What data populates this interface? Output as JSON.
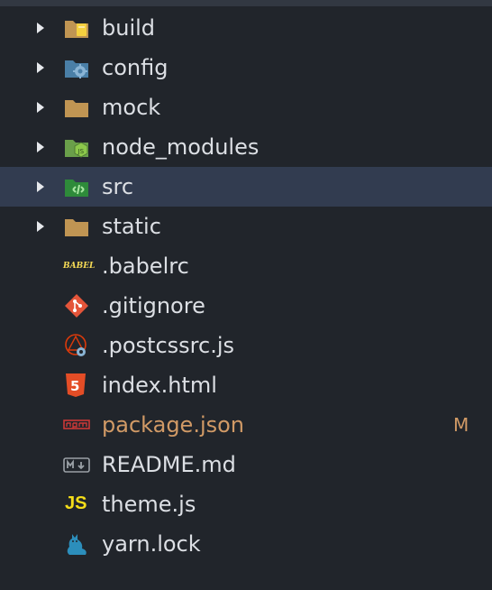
{
  "tree": {
    "rows": [
      {
        "name": "build",
        "type": "folder",
        "icon": "folder-build-icon"
      },
      {
        "name": "config",
        "type": "folder",
        "icon": "folder-config-icon"
      },
      {
        "name": "mock",
        "type": "folder",
        "icon": "folder-icon"
      },
      {
        "name": "node_modules",
        "type": "folder",
        "icon": "folder-node-icon"
      },
      {
        "name": "src",
        "type": "folder",
        "icon": "folder-src-icon",
        "selected": true
      },
      {
        "name": "static",
        "type": "folder",
        "icon": "folder-icon"
      },
      {
        "name": ".babelrc",
        "type": "file",
        "icon": "babel-icon",
        "icon_text": "BABEL"
      },
      {
        "name": ".gitignore",
        "type": "file",
        "icon": "git-icon"
      },
      {
        "name": ".postcssrc.js",
        "type": "file",
        "icon": "postcss-config-icon"
      },
      {
        "name": "index.html",
        "type": "file",
        "icon": "html5-icon",
        "icon_text": "5"
      },
      {
        "name": "package.json",
        "type": "file",
        "icon": "npm-icon",
        "status": "M"
      },
      {
        "name": "README.md",
        "type": "file",
        "icon": "markdown-icon"
      },
      {
        "name": "theme.js",
        "type": "file",
        "icon": "javascript-icon",
        "icon_text": "JS"
      },
      {
        "name": "yarn.lock",
        "type": "file",
        "icon": "yarn-cat-icon"
      }
    ]
  },
  "colors": {
    "background": "#21252b",
    "selected": "#323c50",
    "text": "#dcdfe4",
    "modified": "#d19a66",
    "folder": "#c09553"
  }
}
